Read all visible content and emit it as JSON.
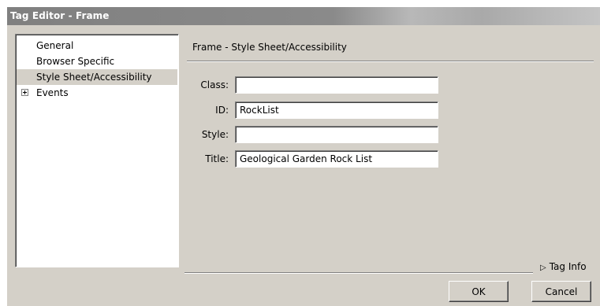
{
  "window": {
    "title": "Tag Editor - Frame"
  },
  "tree": {
    "items": [
      {
        "label": "General",
        "selected": false,
        "expandable": false
      },
      {
        "label": "Browser Specific",
        "selected": false,
        "expandable": false
      },
      {
        "label": "Style Sheet/Accessibility",
        "selected": true,
        "expandable": false
      },
      {
        "label": "Events",
        "selected": false,
        "expandable": true
      }
    ]
  },
  "panel": {
    "heading": "Frame - Style Sheet/Accessibility",
    "fields": {
      "class": {
        "label": "Class:",
        "value": ""
      },
      "id": {
        "label": "ID:",
        "value": "RockList"
      },
      "style": {
        "label": "Style:",
        "value": ""
      },
      "title": {
        "label": "Title:",
        "value": "Geological Garden Rock List"
      }
    }
  },
  "footer": {
    "tag_info": "Tag Info",
    "tag_info_icon": "triangle-right-icon",
    "ok": "OK",
    "cancel": "Cancel"
  }
}
